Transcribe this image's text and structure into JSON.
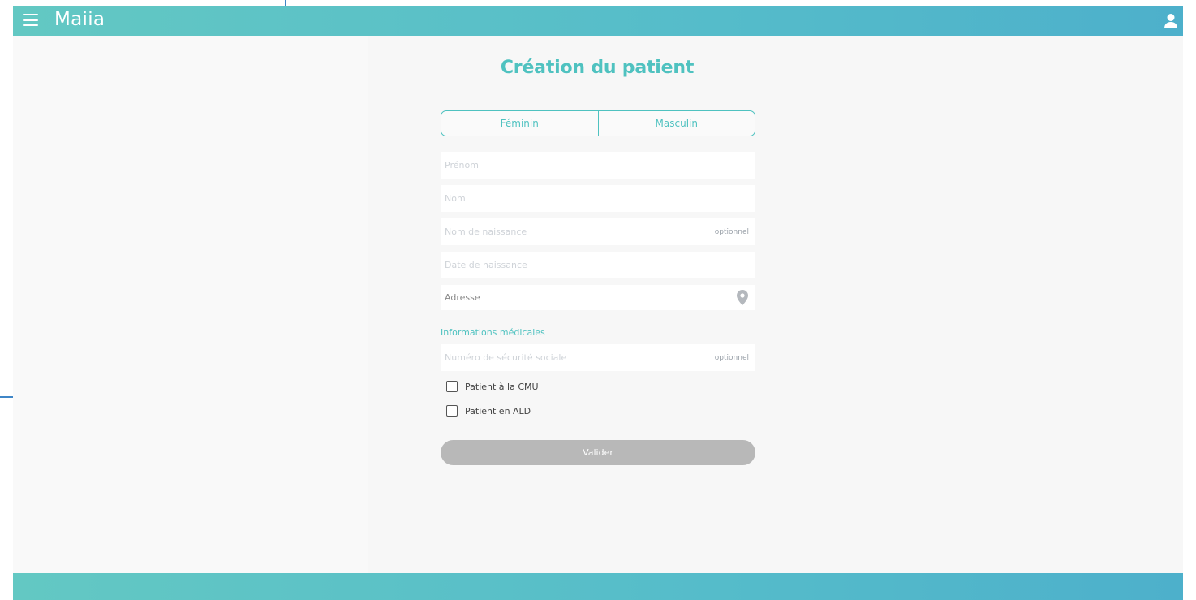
{
  "header": {
    "brand": "Maiia"
  },
  "form": {
    "title": "Création du patient",
    "gender": {
      "female": "Féminin",
      "male": "Masculin"
    },
    "fields": {
      "first_name": {
        "placeholder": "Prénom",
        "value": ""
      },
      "last_name": {
        "placeholder": "Nom",
        "value": ""
      },
      "birth_name": {
        "placeholder": "Nom de naissance",
        "value": "",
        "tag": "optionnel"
      },
      "birth_date": {
        "placeholder": "Date de naissance",
        "value": ""
      },
      "address": {
        "label": "Adresse"
      }
    },
    "medical": {
      "title": "Informations médicales",
      "social_security": {
        "placeholder": "Numéro de sécurité sociale",
        "value": "",
        "tag": "optionnel"
      },
      "cmu_label": "Patient à la CMU",
      "ald_label": "Patient en ALD"
    },
    "submit_label": "Valider"
  },
  "icons": {
    "menu": "hamburger-icon",
    "user": "user-icon",
    "address": "location-pin-icon"
  },
  "colors": {
    "brand_teal": "#4fc2c0",
    "header_gradient_start": "#63c8c3",
    "header_gradient_end": "#4db0cb",
    "submit_disabled": "#b8b8b8"
  }
}
